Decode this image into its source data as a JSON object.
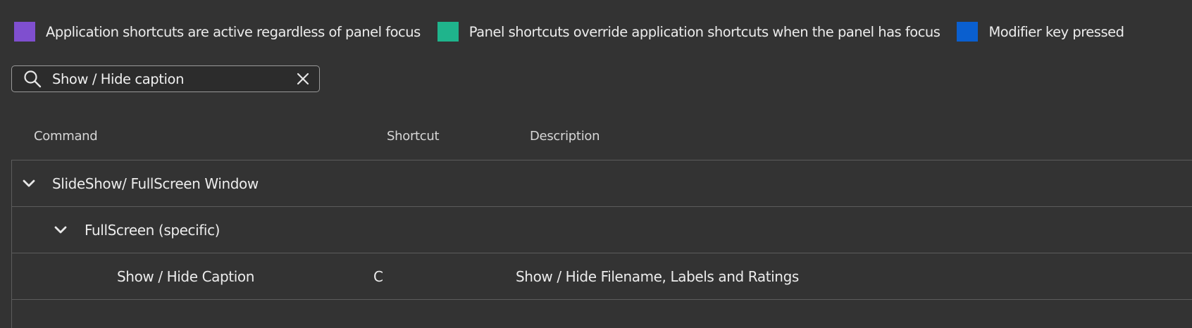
{
  "legend": [
    {
      "label": "Application shortcuts are active regardless of panel focus",
      "color": "#7f4fcf"
    },
    {
      "label": "Panel shortcuts override application shortcuts when the panel has focus",
      "color": "#1fb48c"
    },
    {
      "label": "Modifier key pressed",
      "color": "#0a5fcf"
    }
  ],
  "search": {
    "value": "Show / Hide caption",
    "icon": "search-icon",
    "clear_icon": "close-icon"
  },
  "table": {
    "columns": [
      "Command",
      "Shortcut",
      "Description"
    ],
    "group": {
      "label": "SlideShow/ FullScreen Window",
      "icon": "chevron-down-icon",
      "subgroup": {
        "label": "FullScreen (specific)",
        "icon": "chevron-down-icon",
        "item": {
          "command": "Show / Hide Caption",
          "shortcut": "C",
          "description": "Show / Hide Filename, Labels and Ratings"
        }
      }
    }
  }
}
